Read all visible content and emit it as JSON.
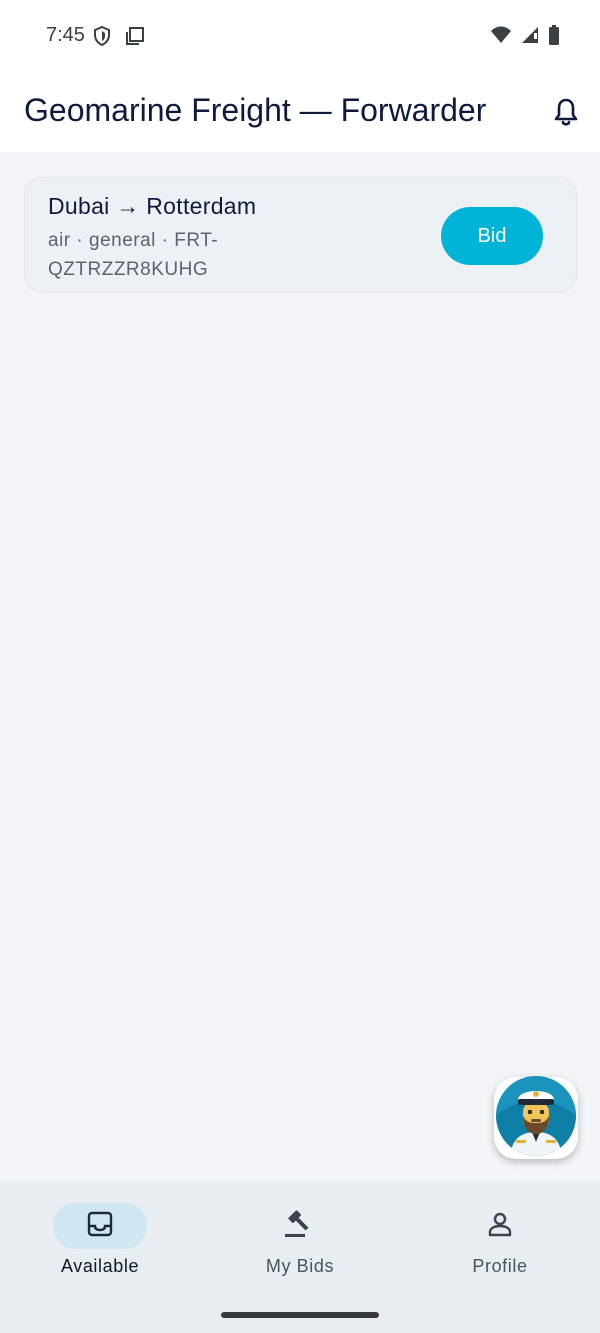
{
  "status_bar": {
    "time": "7:45"
  },
  "app_bar": {
    "title": "Geomarine Freight — Forwarder"
  },
  "shipments": [
    {
      "route": "Dubai → Rotterdam",
      "meta": "air · general · FRT-QZTRZZR8KUHG",
      "action_label": "Bid"
    }
  ],
  "bottom_nav": {
    "items": [
      {
        "label": "Available",
        "icon": "inbox-icon",
        "active": true
      },
      {
        "label": "My Bids",
        "icon": "gavel-icon",
        "active": false
      },
      {
        "label": "Profile",
        "icon": "person-icon",
        "active": false
      }
    ]
  },
  "colors": {
    "accent": "#00b4d8",
    "title": "#0f1b3d",
    "background": "#f3f5f9",
    "nav_active_pill": "#cfe7f1"
  }
}
